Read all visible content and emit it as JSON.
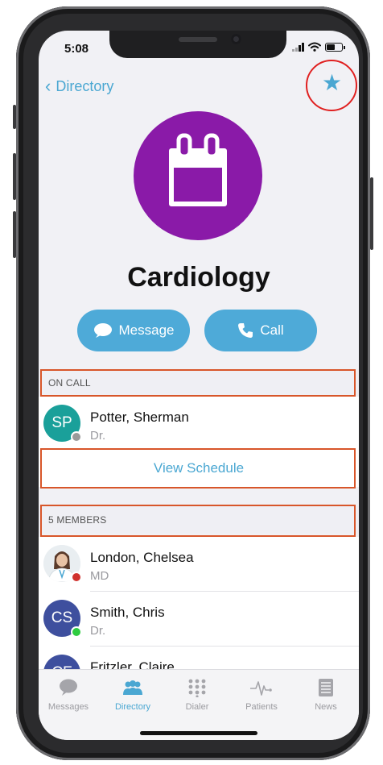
{
  "status_bar": {
    "time": "5:08"
  },
  "nav": {
    "back_label": "Directory"
  },
  "department": {
    "name": "Cardiology",
    "icon": "calendar-icon",
    "color": "#8a1aa8"
  },
  "actions": {
    "message_label": "Message",
    "call_label": "Call"
  },
  "on_call": {
    "header": "ON CALL",
    "person": {
      "initials": "SP",
      "name": "Potter, Sherman",
      "title": "Dr.",
      "status": "offline"
    },
    "view_schedule_label": "View Schedule"
  },
  "members": {
    "header": "5 MEMBERS",
    "list": [
      {
        "initials": "",
        "name": "London, Chelsea",
        "title": "MD",
        "status": "busy",
        "photo": true
      },
      {
        "initials": "CS",
        "name": "Smith, Chris",
        "title": "Dr.",
        "status": "online"
      },
      {
        "initials": "CF",
        "name": "Fritzler, Claire",
        "title": "",
        "status": ""
      }
    ]
  },
  "tabs": [
    {
      "label": "Messages",
      "icon": "chat-bubble-icon"
    },
    {
      "label": "Directory",
      "icon": "people-icon"
    },
    {
      "label": "Dialer",
      "icon": "keypad-icon"
    },
    {
      "label": "Patients",
      "icon": "pulse-icon"
    },
    {
      "label": "News",
      "icon": "newspaper-icon"
    }
  ],
  "colors": {
    "accent": "#4aa7d2",
    "highlight": "#d8562a",
    "favorite_ring": "#e02020",
    "status_online": "#2ecc40",
    "status_busy": "#d0312d",
    "status_offline": "#9a9a9a"
  }
}
